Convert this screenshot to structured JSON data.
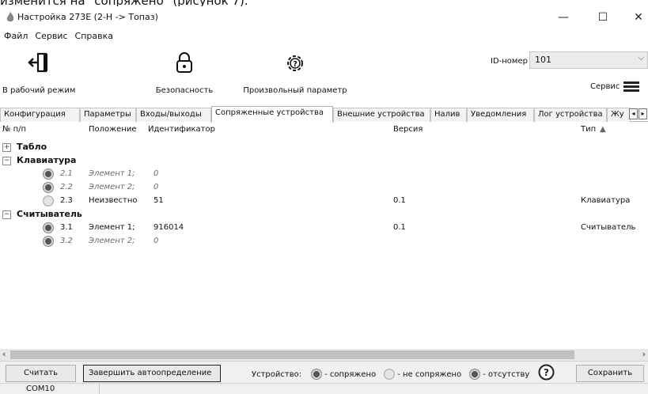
{
  "caption": "изменится на \"сопряжено\" (рисунок 7).",
  "window": {
    "title": "Настройка 273E (2-H -> Топаз)",
    "controls": {
      "minimize": "—",
      "maximize": "☐",
      "close": "✕"
    }
  },
  "menu": [
    "Файл",
    "Сервис",
    "Справка"
  ],
  "toolbar": {
    "work_mode": "В рабочий режим",
    "security": "Безопасность",
    "custom_param": "Произвольный параметр",
    "id_label": "ID-номер",
    "id_value": "101",
    "service": "Сервис"
  },
  "tabs": [
    "Конфигурация",
    "Параметры",
    "Входы/выходы",
    "Сопряженные устройства",
    "Внешние устройства",
    "Налив",
    "Уведомления",
    "Лог устройства",
    "Жу"
  ],
  "active_tab": "Сопряженные устройства",
  "columns": [
    "№ п/п",
    "Положение",
    "Идентификатор",
    "Версия",
    "Тип"
  ],
  "groups": [
    {
      "title": "Табло",
      "expander": "+",
      "items": []
    },
    {
      "title": "Клавиатура",
      "expander": "−",
      "items": [
        {
          "num": "2.1",
          "position": "Элемент 1;",
          "id": "0",
          "version": "",
          "type": "",
          "state": "connected",
          "greyed": true
        },
        {
          "num": "2.2",
          "position": "Элемент 2;",
          "id": "0",
          "version": "",
          "type": "",
          "state": "connected",
          "greyed": true
        },
        {
          "num": "2.3",
          "position": "Неизвестно",
          "id": "51",
          "version": "0.1",
          "type": "Клавиатура",
          "state": "notconnected",
          "greyed": false
        }
      ]
    },
    {
      "title": "Считыватель",
      "expander": "−",
      "items": [
        {
          "num": "3.1",
          "position": "Элемент 1;",
          "id": "916014",
          "version": "0.1",
          "type": "Считыватель",
          "state": "connected",
          "greyed": false
        },
        {
          "num": "3.2",
          "position": "Элемент 2;",
          "id": "0",
          "version": "",
          "type": "",
          "state": "connected",
          "greyed": true
        }
      ]
    }
  ],
  "bottom": {
    "read": "Считать",
    "finish_auto": "Завершить автоопределение",
    "device_label": "Устройство:",
    "legend_connected": "- сопряжено",
    "legend_notconnected": "- не сопряжено",
    "legend_absent": "- отсутству",
    "save": "Сохранить"
  },
  "status": {
    "port": "COM10"
  }
}
